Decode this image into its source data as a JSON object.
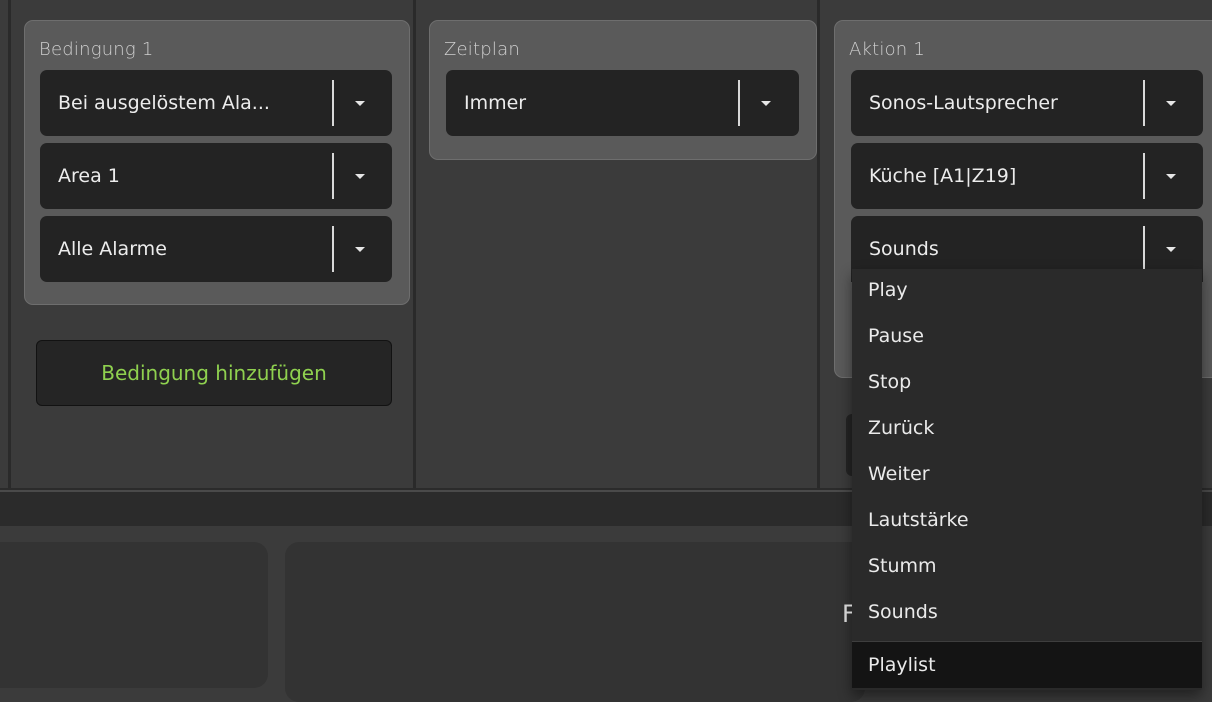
{
  "condition_panel": {
    "title": "Bedingung 1",
    "selects": [
      {
        "value": "Bei ausgelöstem Ala..."
      },
      {
        "value": "Area 1"
      },
      {
        "value": "Alle Alarme"
      }
    ],
    "add_button_label": "Bedingung hinzufügen"
  },
  "schedule_panel": {
    "title": "Zeitplan",
    "select": {
      "value": "Immer"
    }
  },
  "action_panel": {
    "title": "Aktion 1",
    "selects": [
      {
        "value": "Sonos-Lautsprecher"
      },
      {
        "value": "Küche [A1|Z19]"
      },
      {
        "value": "Sounds"
      }
    ]
  },
  "action_dropdown_menu": {
    "items": [
      "Play",
      "Pause",
      "Stop",
      "Zurück",
      "Weiter",
      "Lautstärke",
      "Stumm",
      "Sounds",
      "Playlist"
    ],
    "highlighted_item": "Playlist"
  },
  "colors": {
    "accent_green": "#8fd14f",
    "panel_bg": "#5a5a5a",
    "select_bg": "#232323",
    "page_bg": "#3b3b3b"
  },
  "icons": {
    "caret": "chevron-down-icon"
  }
}
